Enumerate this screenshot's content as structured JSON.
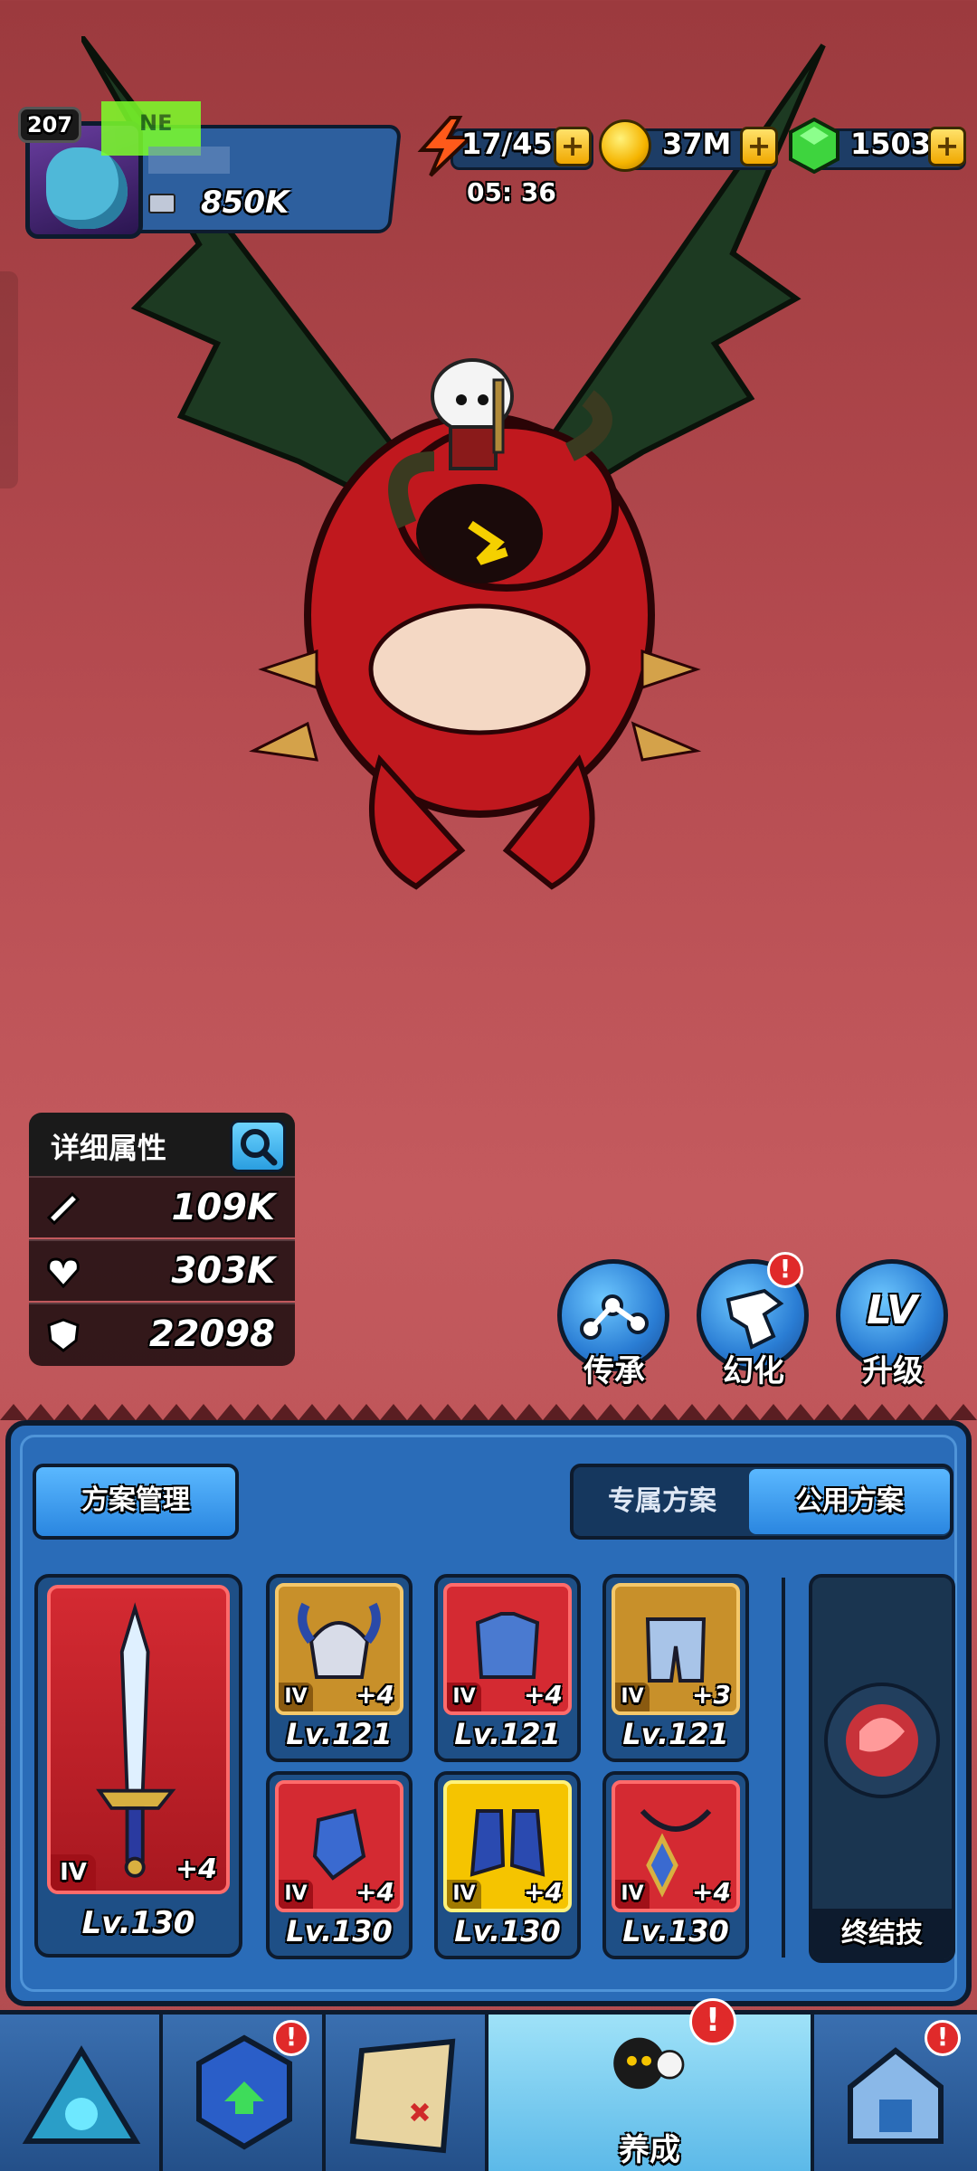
{
  "player": {
    "level": "207",
    "tag": "NE",
    "power": "850K"
  },
  "resources": {
    "energy": "17/45",
    "energy_timer": "05: 36",
    "coins": "37M",
    "gems": "1503",
    "plus": "+"
  },
  "stats": {
    "title": "详细属性",
    "attack": "109K",
    "hp": "303K",
    "defense": "22098"
  },
  "actions": [
    {
      "label": "传承"
    },
    {
      "label": "幻化"
    },
    {
      "label": "升级",
      "icon_text": "LV"
    }
  ],
  "alert": "!",
  "plan": {
    "manage_label": "方案管理",
    "tab_exclusive": "专属方案",
    "tab_public": "公用方案"
  },
  "weapon": {
    "tier": "IV",
    "plus": "+4",
    "level": "Lv.130"
  },
  "equipment": [
    {
      "tier": "IV",
      "plus": "+4",
      "level": "Lv.121",
      "rarity": "gold"
    },
    {
      "tier": "IV",
      "plus": "+4",
      "level": "Lv.121",
      "rarity": "red"
    },
    {
      "tier": "IV",
      "plus": "+3",
      "level": "Lv.121",
      "rarity": "gold"
    },
    {
      "tier": "IV",
      "plus": "+4",
      "level": "Lv.130",
      "rarity": "red"
    },
    {
      "tier": "IV",
      "plus": "+4",
      "level": "Lv.130",
      "rarity": "yellow"
    },
    {
      "tier": "IV",
      "plus": "+4",
      "level": "Lv.130",
      "rarity": "red"
    }
  ],
  "ultimate": {
    "label": "终结技"
  },
  "nav": {
    "active_label": "养成"
  },
  "colors": {
    "panel_blue": "#2a6cb8",
    "card_red": "#d42a32",
    "card_gold": "#c8902a",
    "accent_yellow": "#f5c400"
  }
}
